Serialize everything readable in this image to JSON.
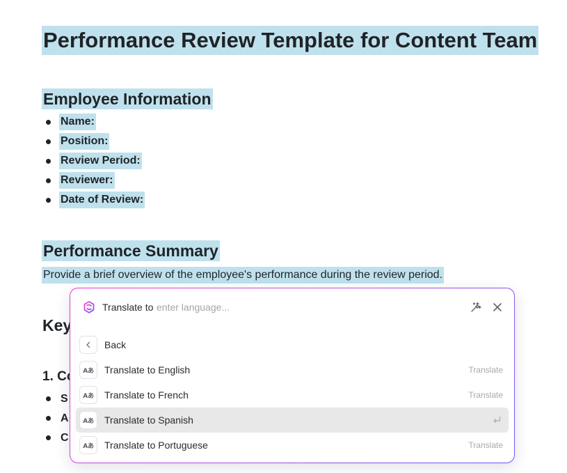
{
  "document": {
    "title": "Performance Review Template for Content Team",
    "employee_info": {
      "heading": "Employee Information",
      "items": [
        "Name:",
        "Position:",
        "Review Period:",
        "Reviewer:",
        "Date of Review:"
      ]
    },
    "performance_summary": {
      "heading": "Performance Summary",
      "text": "Provide a brief overview of the employee's performance during the review period."
    },
    "key_heading_visible": "Key",
    "sub_heading_visible": "1. Co",
    "background_list_letters": [
      "S",
      "A",
      "C"
    ]
  },
  "translate_panel": {
    "prompt_label": "Translate to",
    "input_placeholder": "enter language...",
    "input_value": "",
    "back_label": "Back",
    "options": [
      {
        "icon": "translate-icon",
        "icon_text": "Aあ",
        "label": "Translate to English",
        "hint": "Translate",
        "selected": false
      },
      {
        "icon": "translate-icon",
        "icon_text": "Aあ",
        "label": "Translate to French",
        "hint": "Translate",
        "selected": false
      },
      {
        "icon": "translate-icon",
        "icon_text": "Aあ",
        "label": "Translate to Spanish",
        "hint": "",
        "selected": true
      },
      {
        "icon": "translate-icon",
        "icon_text": "Aあ",
        "label": "Translate to Portuguese",
        "hint": "Translate",
        "selected": false
      }
    ]
  },
  "colors": {
    "selection_highlight": "#bfe1ed",
    "panel_border_start": "#e33ad6",
    "panel_border_end": "#6b5bf3",
    "selected_row": "#e8e8e9"
  }
}
